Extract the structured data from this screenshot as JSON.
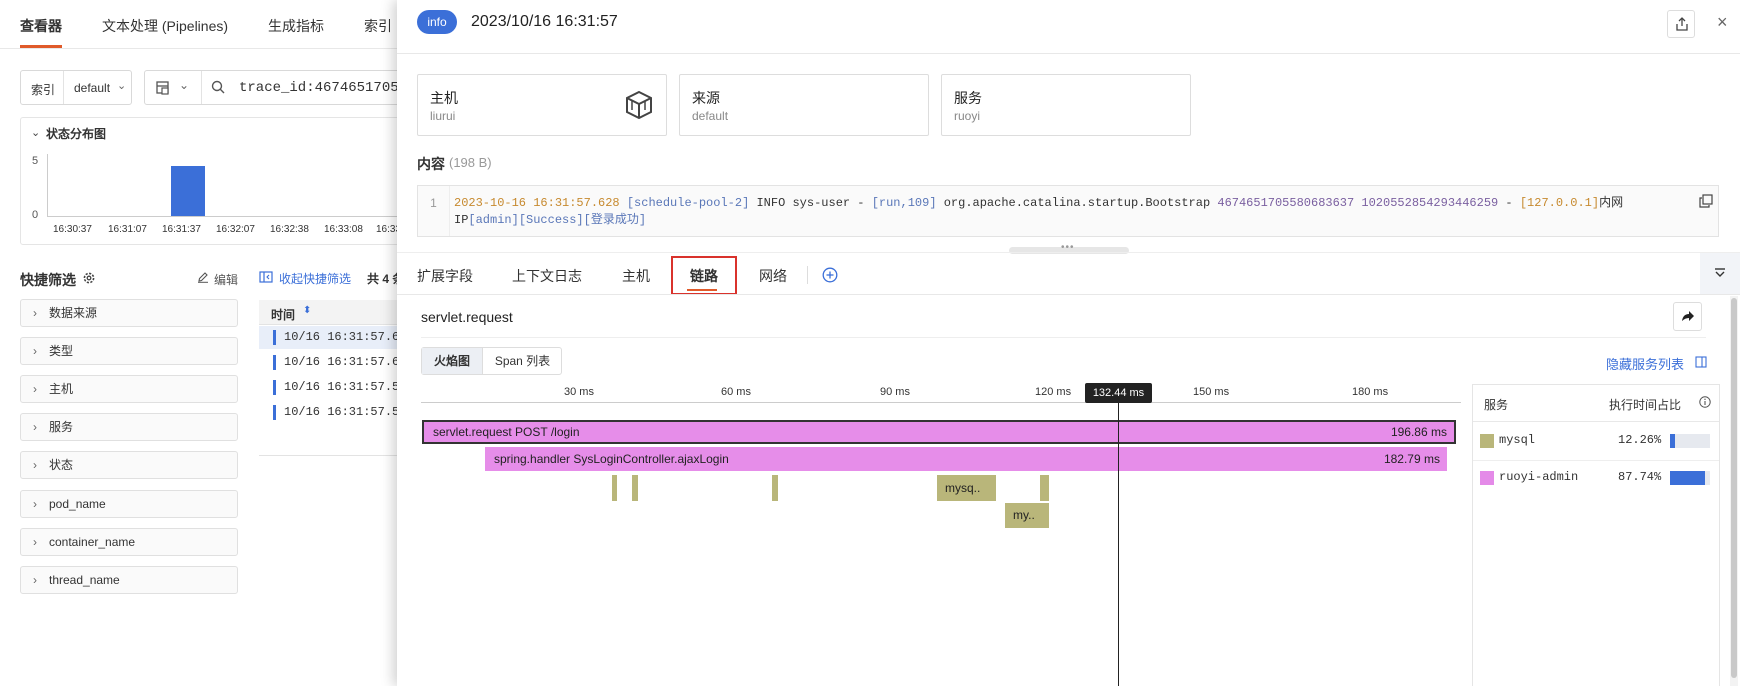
{
  "nav": {
    "tabs": [
      "查看器",
      "文本处理 (Pipelines)",
      "生成指标",
      "索引"
    ]
  },
  "search": {
    "index_label": "索引",
    "index_value": "default",
    "query": "trace_id:4674651705"
  },
  "histogram": {
    "title": "状态分布图",
    "y_ticks": [
      "5",
      "0"
    ],
    "x_ticks": [
      "16:30:37",
      "16:31:07",
      "16:31:37",
      "16:32:07",
      "16:32:38",
      "16:33:08",
      "16:33"
    ],
    "chart_data": {
      "type": "bar",
      "categories": [
        "16:30:37",
        "16:31:07",
        "16:31:37",
        "16:32:07",
        "16:32:38",
        "16:33:08"
      ],
      "values": [
        0,
        0,
        4,
        0,
        0,
        0
      ],
      "ylim": [
        0,
        5
      ]
    }
  },
  "quick_filter": {
    "title": "快捷筛选",
    "edit_label": "编辑",
    "collapse_label": "收起快捷筛选",
    "count_prefix": "共 4 条",
    "items": [
      "数据来源",
      "类型",
      "主机",
      "服务",
      "状态",
      "pod_name",
      "container_name",
      "thread_name"
    ]
  },
  "table": {
    "time_header": "时间",
    "rows": [
      "10/16 16:31:57.6",
      "10/16 16:31:57.6",
      "10/16 16:31:57.5",
      "10/16 16:31:57.5"
    ]
  },
  "drawer": {
    "level": "info",
    "time": "2023/10/16 16:31:57",
    "cards": [
      {
        "title": "主机",
        "value": "liurui"
      },
      {
        "title": "来源",
        "value": "default"
      },
      {
        "title": "服务",
        "value": "ruoyi"
      }
    ],
    "content_label": "内容",
    "content_size": "(198 B)",
    "line_number": "1",
    "log": {
      "timestamp": "2023-10-16 16:31:57.628",
      "thread": "[schedule-pool-2]",
      "level": "INFO",
      "user": "sys-user - ",
      "loc": "[run,109]",
      "class": "org.apache.catalina.startup.Bootstrap",
      "trace_id": "4674651705580683637",
      "span_id": "1020552854293446259",
      "dash": " - ",
      "ip": "[127.0.0.1]",
      "ip_label": "内网",
      "ip_word": "IP",
      "tail": "[admin][Success][登录成功]"
    },
    "tabs": [
      "扩展字段",
      "上下文日志",
      "主机",
      "链路",
      "网络"
    ],
    "active_tab": "链路"
  },
  "trace": {
    "title": "servlet.request",
    "view_tabs": [
      "火焰图",
      "Span 列表"
    ],
    "hide_services_label": "隐藏服务列表",
    "axis_ticks": [
      "30 ms",
      "60 ms",
      "90 ms",
      "120 ms",
      "150 ms",
      "180 ms"
    ],
    "cursor_label": "132.44 ms",
    "spans": [
      {
        "name": "servlet.request POST /login",
        "duration": "196.86 ms"
      },
      {
        "name": "spring.handler SysLoginController.ajaxLogin",
        "duration": "182.79 ms"
      },
      {
        "name": "mysq.."
      },
      {
        "name": "my.."
      }
    ],
    "services_header": "服务",
    "exec_header": "执行时间占比",
    "services": [
      {
        "name": "mysql",
        "pct": "12.26%",
        "fraction": 0.1226,
        "color": "#b9b67a"
      },
      {
        "name": "ruoyi-admin",
        "pct": "87.74%",
        "fraction": 0.8774,
        "color": "#e48ae8"
      }
    ]
  }
}
